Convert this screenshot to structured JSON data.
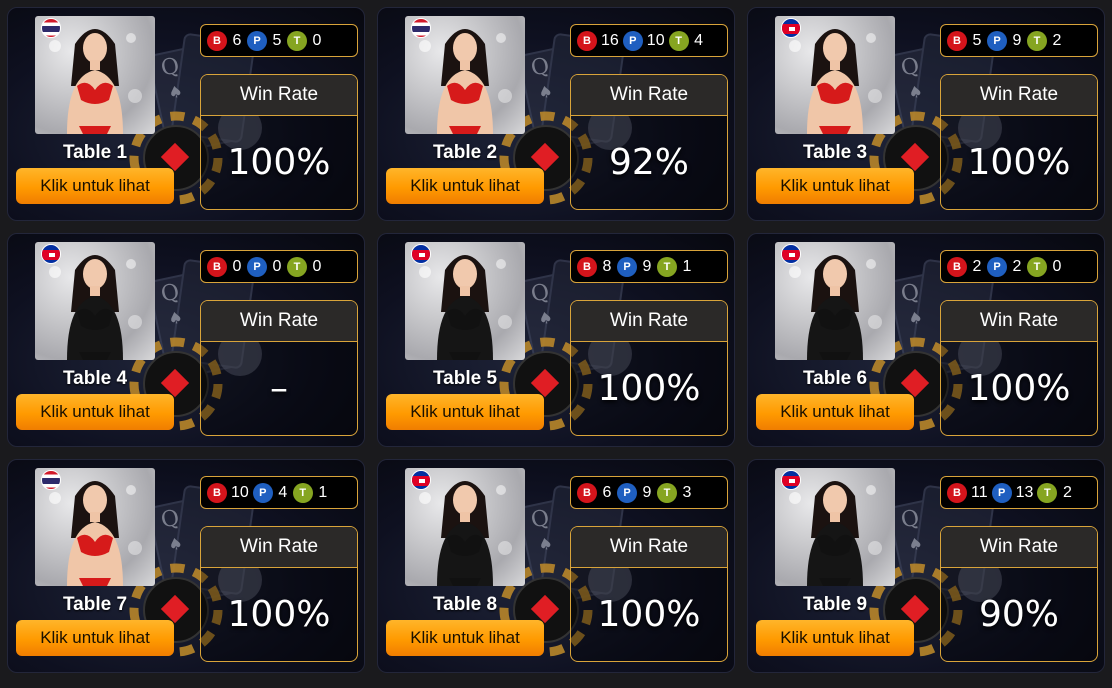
{
  "cta_label": "Klik untuk lihat",
  "win_rate_label": "Win Rate",
  "badge_letters": {
    "banker": "B",
    "player": "P",
    "tie": "T"
  },
  "colors": {
    "accent": "#ff9a00",
    "border_gold": "#d9a43a",
    "banker": "#d4141b",
    "player": "#1f5fc0",
    "tie": "#86a521"
  },
  "tables": [
    {
      "name": "Table 1",
      "flag": "thailand-flag-icon",
      "outfit": "red-bikini",
      "banker": "6",
      "player": "5",
      "tie": "0",
      "win_rate": "100%"
    },
    {
      "name": "Table 2",
      "flag": "thailand-flag-icon",
      "outfit": "red-bikini",
      "banker": "16",
      "player": "10",
      "tie": "4",
      "win_rate": "92%"
    },
    {
      "name": "Table 3",
      "flag": "cambodia-flag-icon",
      "outfit": "red-bikini",
      "banker": "5",
      "player": "9",
      "tie": "2",
      "win_rate": "100%"
    },
    {
      "name": "Table 4",
      "flag": "cambodia-flag-icon",
      "outfit": "black-lace",
      "banker": "0",
      "player": "0",
      "tie": "0",
      "win_rate": "–"
    },
    {
      "name": "Table 5",
      "flag": "cambodia-flag-icon",
      "outfit": "black-lace",
      "banker": "8",
      "player": "9",
      "tie": "1",
      "win_rate": "100%"
    },
    {
      "name": "Table 6",
      "flag": "cambodia-flag-icon",
      "outfit": "black-lace",
      "banker": "2",
      "player": "2",
      "tie": "0",
      "win_rate": "100%"
    },
    {
      "name": "Table 7",
      "flag": "thailand-flag-icon",
      "outfit": "red-bikini",
      "banker": "10",
      "player": "4",
      "tie": "1",
      "win_rate": "100%"
    },
    {
      "name": "Table 8",
      "flag": "cambodia-flag-icon",
      "outfit": "black-lace",
      "banker": "6",
      "player": "9",
      "tie": "3",
      "win_rate": "100%"
    },
    {
      "name": "Table 9",
      "flag": "cambodia-flag-icon",
      "outfit": "black-lace",
      "banker": "11",
      "player": "13",
      "tie": "2",
      "win_rate": "90%"
    }
  ]
}
